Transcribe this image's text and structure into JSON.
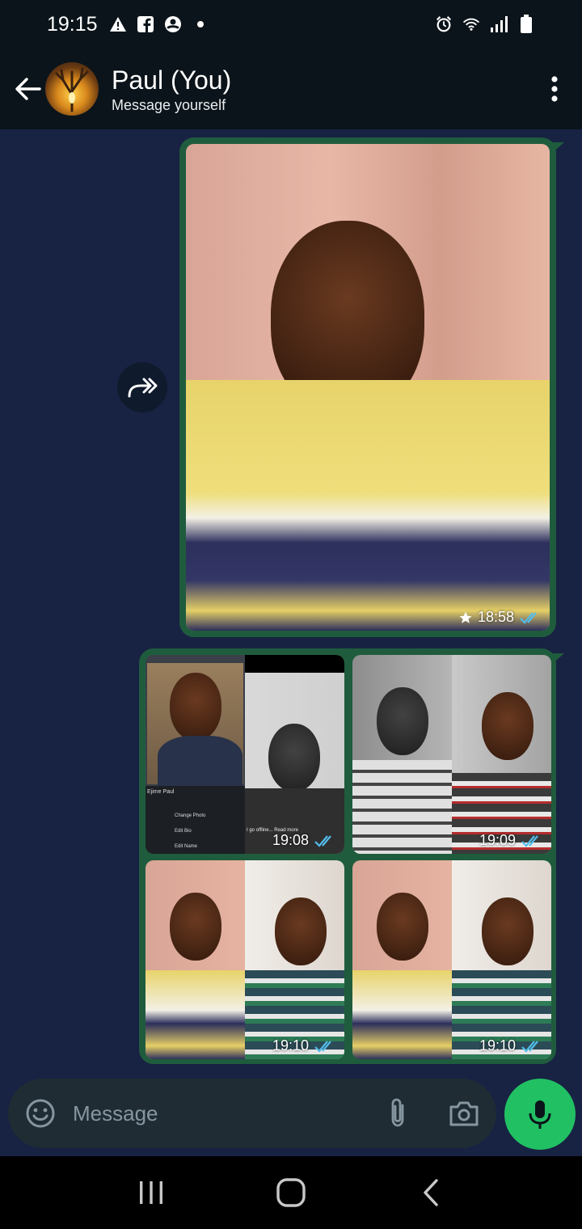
{
  "status_bar": {
    "time": "19:15",
    "left_icons": [
      "warning-icon",
      "facebook-icon",
      "account-icon",
      "dot-icon"
    ],
    "right_icons": [
      "alarm-icon",
      "wifi-icon",
      "signal-icon",
      "battery-icon"
    ]
  },
  "header": {
    "title": "Paul (You)",
    "subtitle": "Message yourself"
  },
  "messages": [
    {
      "type": "image",
      "time": "18:58",
      "starred": true,
      "read": true
    },
    {
      "type": "image-group",
      "items": [
        {
          "time": "19:08",
          "read": true
        },
        {
          "time": "19:09",
          "read": true
        },
        {
          "time": "19:10",
          "read": true
        },
        {
          "time": "19:10",
          "read": true
        }
      ]
    }
  ],
  "embedded_screenshot_text": {
    "name": "Ejime Paul",
    "menu": [
      "Change Photo",
      "Edit Bio",
      "Edit Name"
    ],
    "caption": "I go offline...  Read more"
  },
  "input": {
    "placeholder": "Message"
  },
  "colors": {
    "chat_bg": "#182243",
    "bubble": "#1f5c3d",
    "accent": "#21c063",
    "read_ticks": "#53bdeb"
  }
}
